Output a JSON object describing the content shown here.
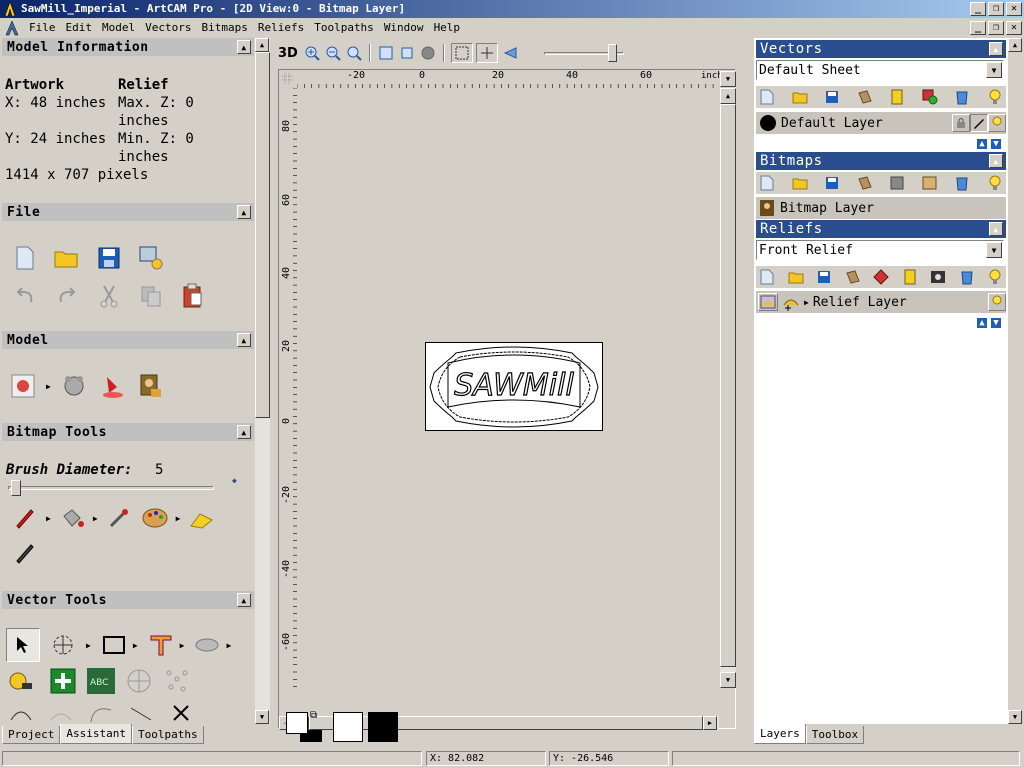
{
  "window": {
    "title": "SawMill_Imperial - ArtCAM Pro - [2D View:0 - Bitmap Layer]"
  },
  "menu": [
    "File",
    "Edit",
    "Model",
    "Vectors",
    "Bitmaps",
    "Reliefs",
    "Toolpaths",
    "Window",
    "Help"
  ],
  "left_panel": {
    "model_info": {
      "title": "Model Information",
      "artwork_label": "Artwork",
      "relief_label": "Relief",
      "x_text": "X: 48 inches",
      "y_text": "Y: 24 inches",
      "max_z_line1": "Max. Z: 0",
      "max_z_line2": "inches",
      "min_z_line1": "Min. Z: 0",
      "min_z_line2": "inches",
      "pixels": "1414 x 707 pixels"
    },
    "file_title": "File",
    "model_title": "Model",
    "bitmap_tools": {
      "title": "Bitmap Tools",
      "brush_label": "Brush Diameter:",
      "brush_value": "5"
    },
    "vector_tools_title": "Vector Tools",
    "tabs": [
      "Project",
      "Assistant",
      "Toolpaths"
    ]
  },
  "view": {
    "toolbar_3d": "3D",
    "zoom_slider_level": 0.9,
    "ruler_top": [
      "-20",
      "0",
      "20",
      "40",
      "60"
    ],
    "ruler_unit": "inches",
    "ruler_left": [
      "80",
      "60",
      "40",
      "20",
      "0",
      "-20",
      "-40",
      "-60"
    ],
    "artwork_text": "SAWMill"
  },
  "right_panel": {
    "vectors": {
      "title": "Vectors",
      "sheet": "Default Sheet",
      "layer": "Default Layer"
    },
    "bitmaps": {
      "title": "Bitmaps",
      "layer": "Bitmap Layer"
    },
    "reliefs": {
      "title": "Reliefs",
      "relief": "Front Relief",
      "layer": "Relief Layer"
    },
    "tabs": [
      "Layers",
      "Toolbox"
    ]
  },
  "status": {
    "x": "X: 82.082",
    "y": "Y: -26.546"
  },
  "colors": {
    "title_start": "#0a246a",
    "title_end": "#a6caf0",
    "panel_header_blue": "#2a4d8d",
    "face": "#d4d0c8"
  }
}
